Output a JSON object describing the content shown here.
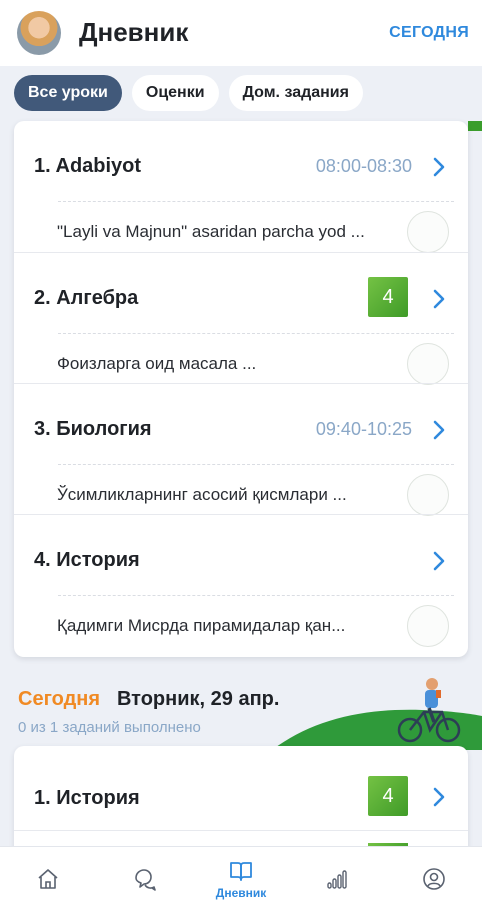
{
  "header": {
    "title": "Дневник",
    "today_link": "СЕГОДНЯ"
  },
  "filters": [
    {
      "label": "Все уроки",
      "active": true
    },
    {
      "label": "Оценки",
      "active": false
    },
    {
      "label": "Дом. задания",
      "active": false
    }
  ],
  "lessons": [
    {
      "name": "1. Adabiyot",
      "time": "08:00-08:30",
      "grade": "",
      "task": "\"Layli va Majnun\" asaridan parcha yod ..."
    },
    {
      "name": "2. Алгебра",
      "time": "",
      "grade": "4",
      "task": "Фоизларга оид масала ..."
    },
    {
      "name": "3. Биология",
      "time": "09:40-10:25",
      "grade": "",
      "task": "Ўсимликларнинг асосий қисмлари ..."
    },
    {
      "name": "4. История",
      "time": "",
      "grade": "",
      "task": "Қадимги Мисрда пирамидалар қан..."
    }
  ],
  "today": {
    "label": "Сегодня",
    "date": "Вторник, 29 апр.",
    "progress": "0 из  1 заданий выполнено"
  },
  "today_lessons": [
    {
      "name": "1. История",
      "grade": "4"
    }
  ],
  "bottom_nav": [
    {
      "icon": "home-icon",
      "label": ""
    },
    {
      "icon": "chat-icon",
      "label": ""
    },
    {
      "icon": "book-icon",
      "label": "Дневник",
      "active": true
    },
    {
      "icon": "stats-icon",
      "label": ""
    },
    {
      "icon": "profile-icon",
      "label": ""
    }
  ],
  "colors": {
    "accent": "#2f89dd",
    "active_chip": "#41597a",
    "grade_green": "#4fa82f",
    "today_orange": "#f08a24",
    "time_blue": "#8aa7c7"
  }
}
